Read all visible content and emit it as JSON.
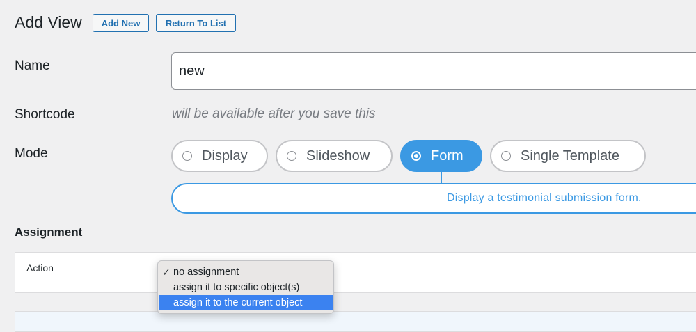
{
  "header": {
    "title": "Add View",
    "add_new_label": "Add New",
    "return_label": "Return To List"
  },
  "fields": {
    "name_label": "Name",
    "name_value": "new",
    "shortcode_label": "Shortcode",
    "shortcode_note": "will be available after you save this",
    "mode_label": "Mode"
  },
  "modes": [
    {
      "label": "Display",
      "selected": false
    },
    {
      "label": "Slideshow",
      "selected": false
    },
    {
      "label": "Form",
      "selected": true
    },
    {
      "label": "Single Template",
      "selected": false
    }
  ],
  "mode_description": "Display a testimonial submission form.",
  "assignment": {
    "heading": "Assignment",
    "action_label": "Action",
    "options": [
      {
        "label": "no assignment",
        "checked": true,
        "highlighted": false
      },
      {
        "label": "assign it to specific object(s)",
        "checked": false,
        "highlighted": false
      },
      {
        "label": "assign it to the current object",
        "checked": false,
        "highlighted": true
      }
    ],
    "check_glyph": "✓"
  },
  "colors": {
    "accent": "#3b99e3",
    "link_blue": "#2271b1",
    "highlight": "#3b82f0",
    "background": "#f0f0f1"
  }
}
